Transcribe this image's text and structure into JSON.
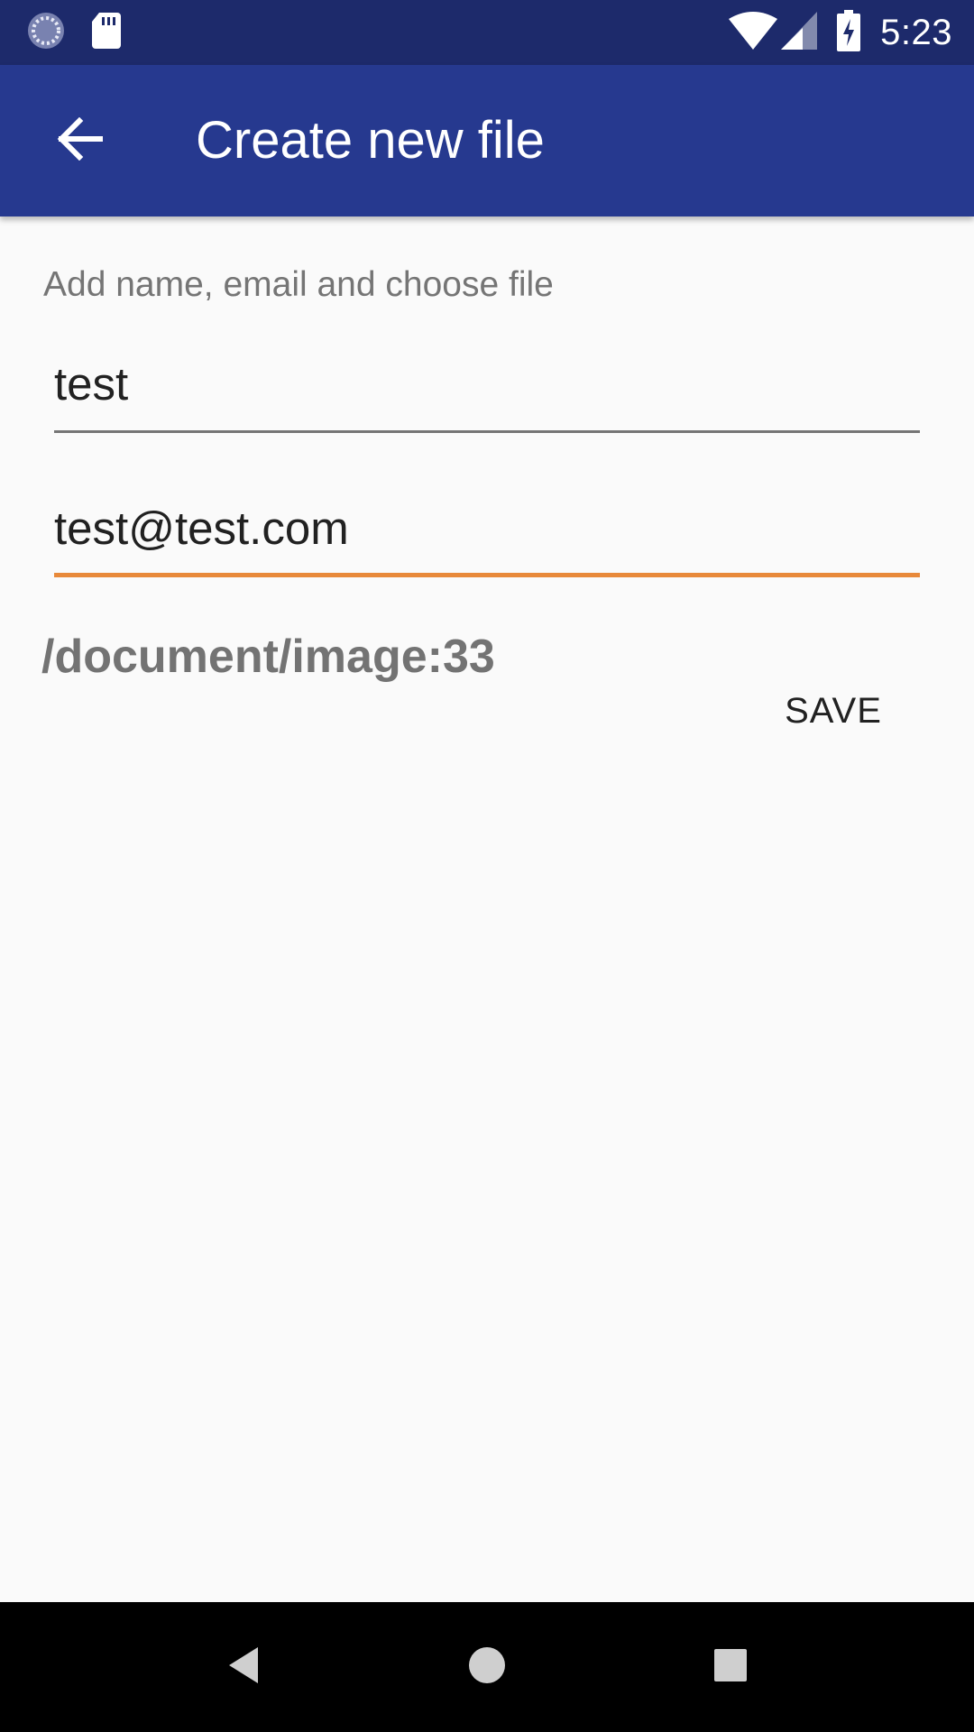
{
  "status_bar": {
    "time": "5:23",
    "left_icons": [
      "sync-icon",
      "sd-card-icon"
    ],
    "right_icons": [
      "wifi-icon",
      "cell-signal-icon",
      "battery-charging-icon"
    ]
  },
  "app_bar": {
    "title": "Create new file",
    "back_icon": "arrow-back-icon"
  },
  "form": {
    "hint": "Add name, email and choose file",
    "name_value": "test",
    "email_value": "test@test.com",
    "file_path": "/document/image:33",
    "save_label": "SAVE"
  },
  "nav_bar": {
    "buttons": [
      "back-triangle-icon",
      "home-circle-icon",
      "recents-square-icon"
    ]
  },
  "colors": {
    "status_bar": "#1d2a6b",
    "app_bar": "#26398f",
    "accent": "#e8893a",
    "background": "#fafafa"
  }
}
